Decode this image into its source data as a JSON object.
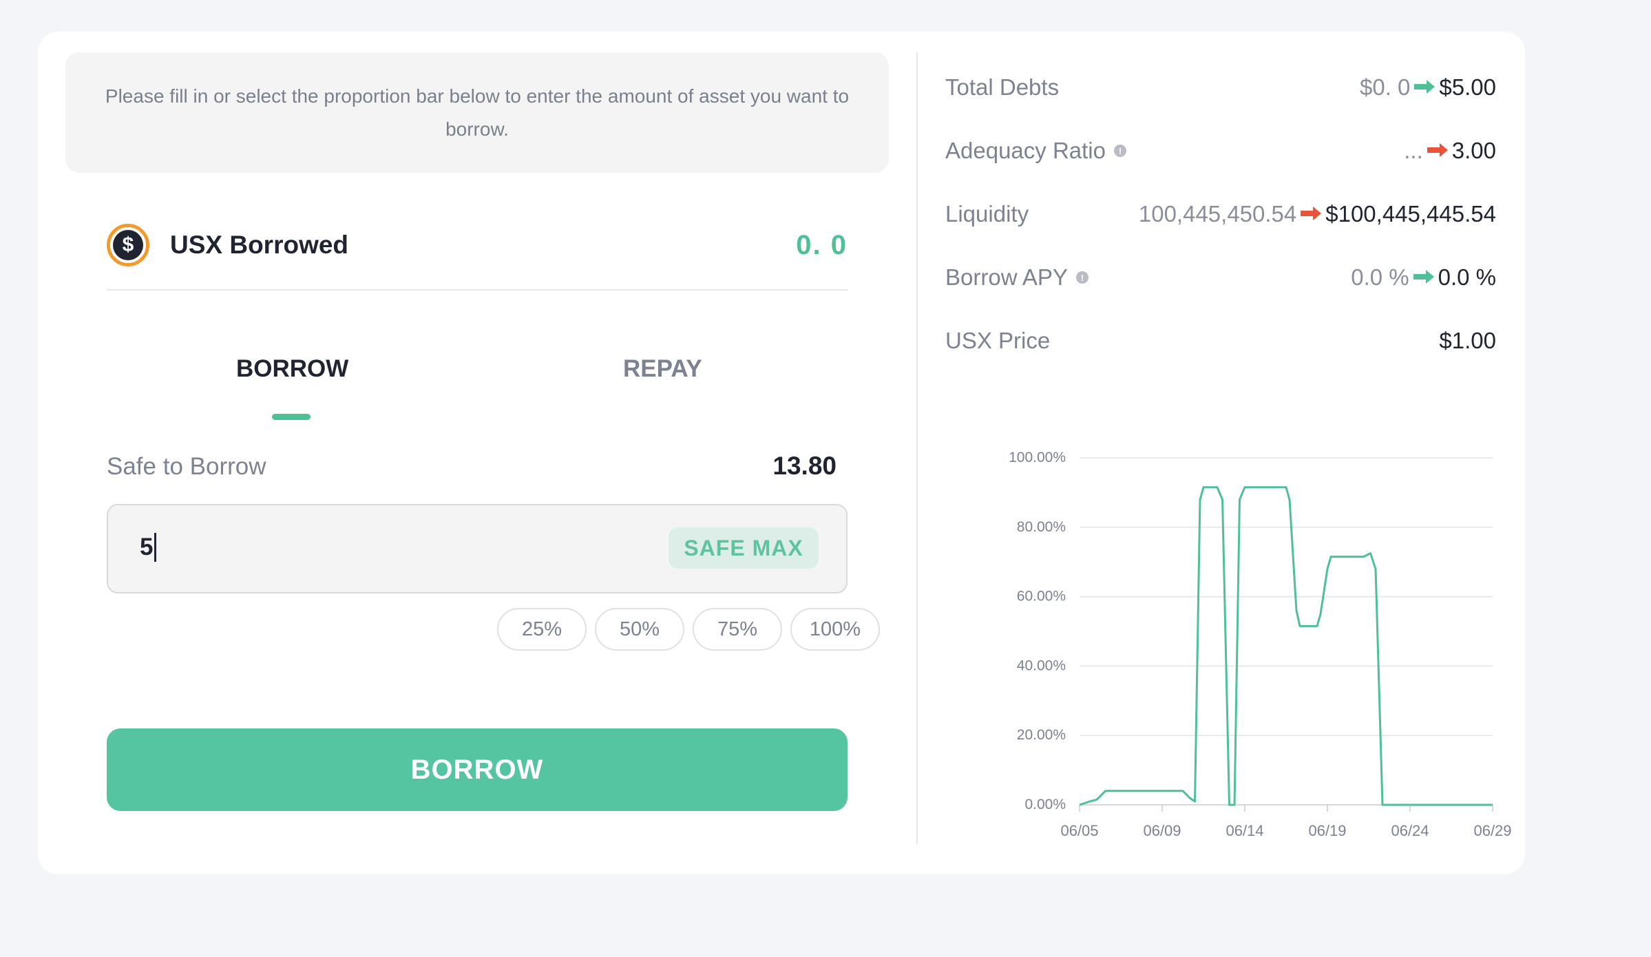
{
  "notice": "Please fill in or select the proportion bar below to enter the amount of asset you want to borrow.",
  "asset": {
    "name": "USX Borrowed",
    "value": "0. 0",
    "icon": "dollar-coin-icon"
  },
  "tabs": [
    {
      "label": "BORROW"
    },
    {
      "label": "REPAY"
    }
  ],
  "safe_to_borrow": {
    "label": "Safe to Borrow",
    "value": "13.80"
  },
  "amount_input": {
    "value": "5"
  },
  "safe_max_label": "SAFE MAX",
  "percent_buttons": [
    "25%",
    "50%",
    "75%",
    "100%"
  ],
  "borrow_button": "BORROW",
  "stats": {
    "total_debts": {
      "label": "Total Debts",
      "old": "$0. 0",
      "new": "$5.00",
      "arrow_color": "#4fbf95"
    },
    "adequacy_ratio": {
      "label": "Adequacy Ratio",
      "old": "...",
      "new": "3.00",
      "arrow_color": "#e8533a"
    },
    "liquidity": {
      "label": "Liquidity",
      "old": "100,445,450.54",
      "new": "$100,445,445.54",
      "arrow_color": "#e8533a"
    },
    "borrow_apy": {
      "label": "Borrow APY",
      "old": "0.0 %",
      "new": "0.0 %",
      "arrow_color": "#4fbf95"
    },
    "usx_price": {
      "label": "USX Price",
      "value": "$1.00"
    }
  },
  "colors": {
    "accent": "#4fbf95",
    "warning": "#e8533a",
    "coin_border": "#f29a2e"
  },
  "chart_data": {
    "type": "line",
    "title": "",
    "xlabel": "",
    "ylabel": "",
    "ylim": [
      0,
      100
    ],
    "y_ticks": [
      "0.00%",
      "20.00%",
      "40.00%",
      "60.00%",
      "80.00%",
      "100.00%"
    ],
    "x_ticks": [
      "06/05",
      "06/09",
      "06/14",
      "06/19",
      "06/24",
      "06/29"
    ],
    "x_range": [
      0,
      24
    ],
    "series": [
      {
        "color": "#4fbf95",
        "points": [
          [
            0,
            0
          ],
          [
            0.6,
            1
          ],
          [
            1.0,
            1.5
          ],
          [
            1.5,
            4
          ],
          [
            2.0,
            4
          ],
          [
            5.5,
            4
          ],
          [
            6.0,
            4
          ],
          [
            6.4,
            2
          ],
          [
            6.7,
            1
          ],
          [
            7.0,
            88
          ],
          [
            7.2,
            91.5
          ],
          [
            8.0,
            91.5
          ],
          [
            8.3,
            88
          ],
          [
            8.7,
            0
          ],
          [
            9.0,
            0
          ],
          [
            9.3,
            88
          ],
          [
            9.6,
            91.5
          ],
          [
            12.0,
            91.5
          ],
          [
            12.2,
            88
          ],
          [
            12.6,
            56
          ],
          [
            12.8,
            51.5
          ],
          [
            13.8,
            51.5
          ],
          [
            14.0,
            55
          ],
          [
            14.4,
            68
          ],
          [
            14.6,
            71.5
          ],
          [
            16.5,
            71.5
          ],
          [
            16.9,
            72.5
          ],
          [
            17.2,
            68
          ],
          [
            17.6,
            0
          ],
          [
            24,
            0
          ]
        ]
      }
    ]
  }
}
